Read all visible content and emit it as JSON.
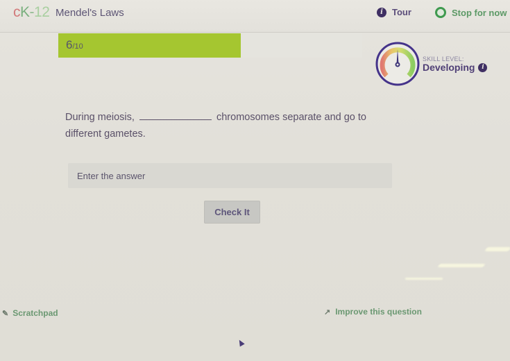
{
  "header": {
    "logo": {
      "c": "c",
      "k": "K",
      "dash": "-",
      "num": "12"
    },
    "title": "Mendel's Laws",
    "tour_label": "Tour",
    "tour_icon": "info-icon",
    "stop_label": "Stop for now",
    "stop_icon": "stop-circle-icon"
  },
  "progress": {
    "current": "6",
    "total": "/10",
    "fraction": 0.6,
    "fill_color": "#a5c630"
  },
  "skill": {
    "label": "SKILL LEVEL:",
    "value": "Developing",
    "gauge_level": 0.5,
    "info_icon": "info-icon"
  },
  "question": {
    "before_blank": "During meiosis,",
    "after_blank": "chromosomes separate and go to different gametes."
  },
  "answer": {
    "placeholder": "Enter the answer",
    "value": ""
  },
  "check_button": {
    "label": "Check It"
  },
  "footer": {
    "scratchpad_label": "Scratchpad",
    "scratchpad_icon": "pencil-icon",
    "improve_label": "Improve this question",
    "improve_icon": "trend-icon"
  }
}
